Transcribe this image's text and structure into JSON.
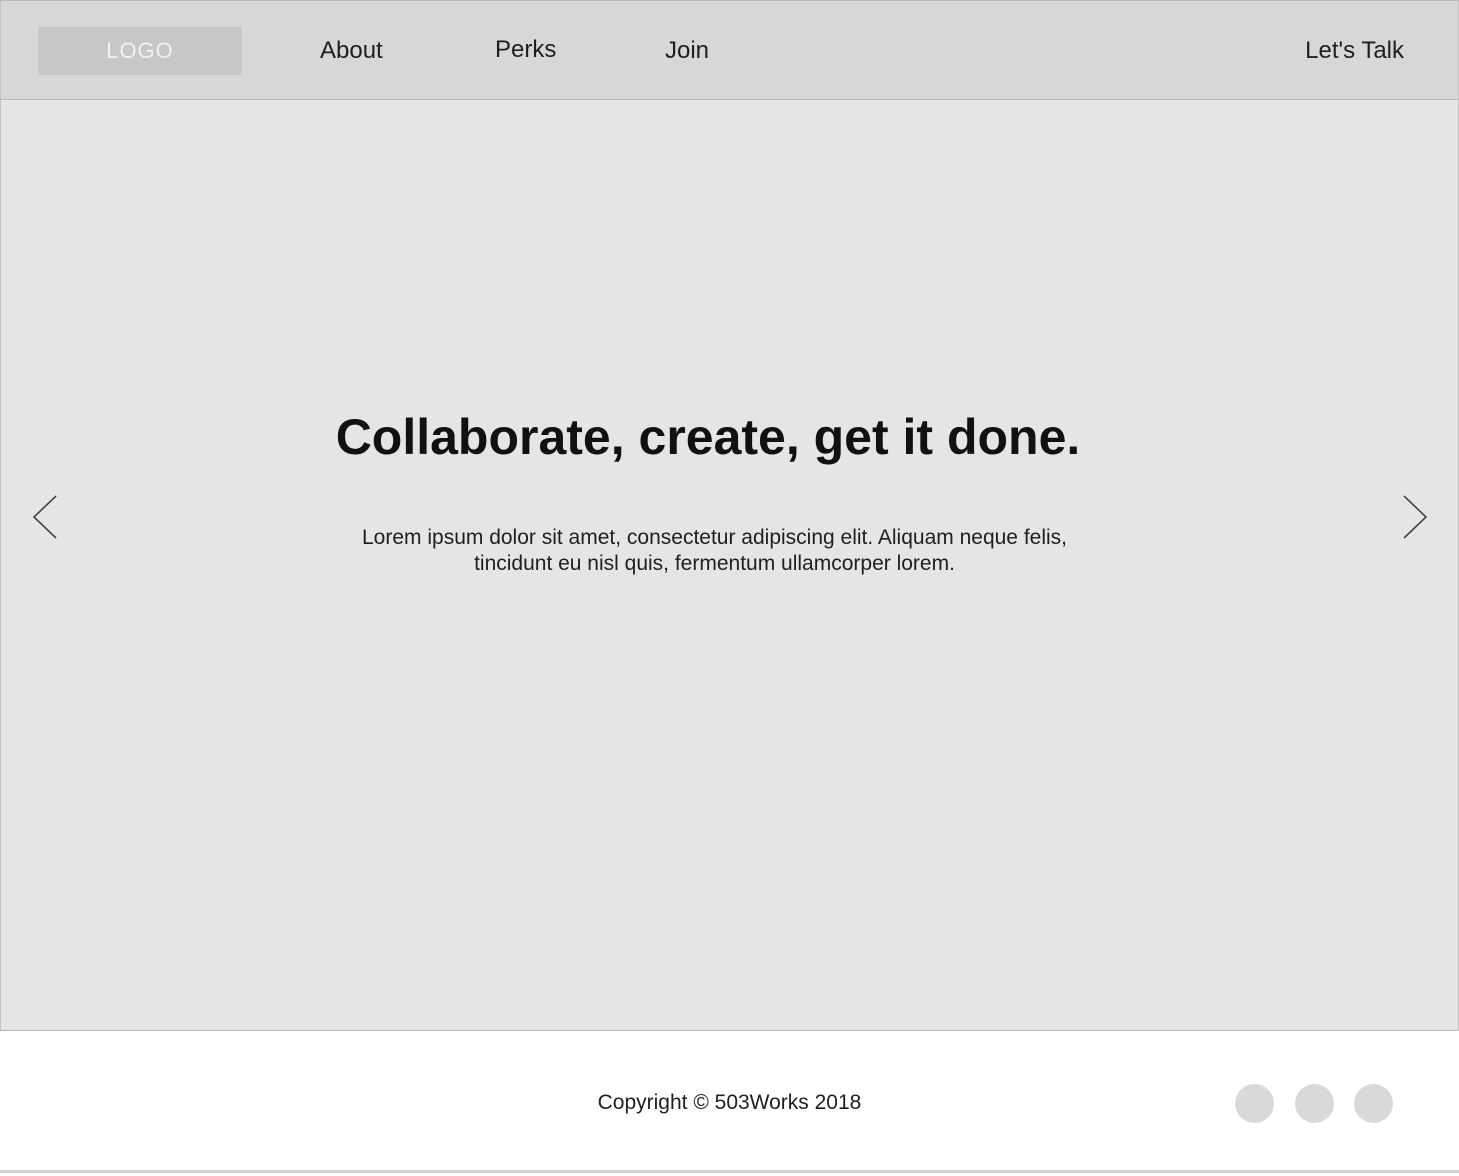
{
  "header": {
    "logo_text": "LOGO",
    "nav": {
      "about": "About",
      "perks": "Perks",
      "join": "Join"
    },
    "cta_label": "Let's Talk"
  },
  "hero": {
    "title": "Collaborate, create, get it done.",
    "body": "Lorem ipsum dolor sit amet, consectetur adipiscing elit. Aliquam neque felis, tincidunt eu nisl quis, fermentum ullamcorper lorem.",
    "prev_icon": "chevron-left-icon",
    "next_icon": "chevron-right-icon"
  },
  "footer": {
    "copyright": "Copyright © 503Works 2018",
    "social_icons": [
      "social-icon",
      "social-icon",
      "social-icon"
    ]
  },
  "colors": {
    "header_bg": "#d7d7d7",
    "logo_bg": "#c7c7c7",
    "hero_bg": "#e5e5e5",
    "footer_bg": "#ffffff",
    "social_circle": "#d9d9d9",
    "text": "#1f1f1f"
  }
}
